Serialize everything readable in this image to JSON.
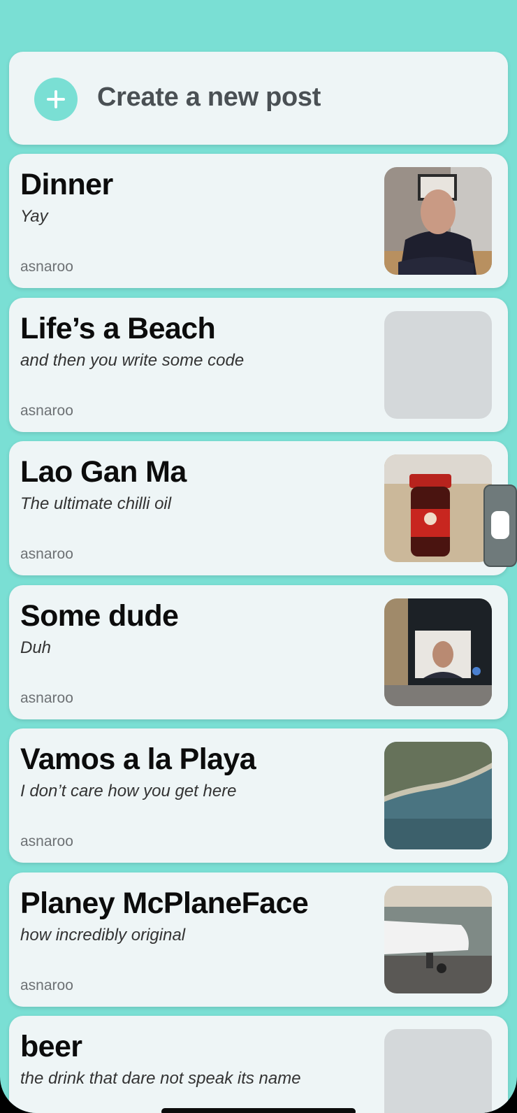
{
  "create_post": {
    "label": "Create a new post",
    "icon": "plus-icon"
  },
  "posts": [
    {
      "title": "Dinner",
      "subtitle": "Yay",
      "author": "asnaroo",
      "thumbnail": "photo-man-at-table"
    },
    {
      "title": "Life’s a Beach",
      "subtitle": "and then you write some code",
      "author": "asnaroo",
      "thumbnail": "placeholder-empty"
    },
    {
      "title": "Lao Gan Ma",
      "subtitle": "The ultimate chilli oil",
      "author": "asnaroo",
      "thumbnail": "photo-chilli-oil-jar"
    },
    {
      "title": "Some dude",
      "subtitle": "Duh",
      "author": "asnaroo",
      "thumbnail": "photo-laptop-screen"
    },
    {
      "title": "Vamos a la Playa",
      "subtitle": "I don’t care how you get here",
      "author": "asnaroo",
      "thumbnail": "photo-aerial-coastline"
    },
    {
      "title": "Planey McPlaneFace",
      "subtitle": "how incredibly original",
      "author": "asnaroo",
      "thumbnail": "photo-airplane"
    },
    {
      "title": "beer",
      "subtitle": "the drink that dare not speak its name",
      "author": "",
      "thumbnail": "placeholder-empty"
    }
  ],
  "colors": {
    "background": "#7adfd4",
    "card": "#eef5f6",
    "accent": "#7adfd4"
  }
}
